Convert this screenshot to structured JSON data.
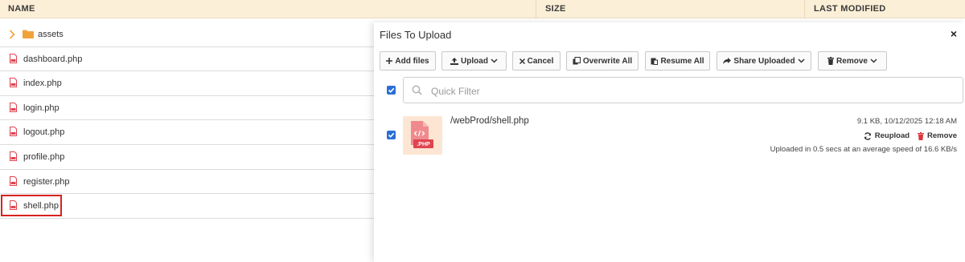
{
  "table": {
    "headers": {
      "name": "NAME",
      "size": "SIZE",
      "modified": "LAST MODIFIED"
    },
    "rows": [
      {
        "name": "assets",
        "type": "folder"
      },
      {
        "name": "dashboard.php",
        "type": "php"
      },
      {
        "name": "index.php",
        "type": "php"
      },
      {
        "name": "login.php",
        "type": "php"
      },
      {
        "name": "logout.php",
        "type": "php"
      },
      {
        "name": "profile.php",
        "type": "php"
      },
      {
        "name": "register.php",
        "type": "php"
      },
      {
        "name": "shell.php",
        "type": "php",
        "highlighted": true
      }
    ]
  },
  "upload_panel": {
    "title": "Files To Upload",
    "close_glyph": "×",
    "toolbar": {
      "add_files": "Add files",
      "upload": "Upload",
      "cancel": "Cancel",
      "overwrite_all": "Overwrite All",
      "resume_all": "Resume All",
      "share_uploaded": "Share Uploaded",
      "remove": "Remove"
    },
    "filter": {
      "placeholder": "Quick Filter",
      "value": ""
    },
    "select_all_checked": true,
    "items": [
      {
        "checked": true,
        "badge": ".PHP",
        "path": "/webProd/shell.php",
        "meta": "9.1 KB, 10/12/2025 12:18 AM",
        "reupload": "Reupload",
        "remove": "Remove",
        "status": "Uploaded in 0.5 secs at an average speed of 16.6 KB/s"
      }
    ]
  },
  "colors": {
    "header_bg": "#fcefd7",
    "accent_blue": "#2a6fd6",
    "highlight_red": "#d6231e",
    "php_red": "#e0444f",
    "folder_orange": "#f0a33a"
  }
}
